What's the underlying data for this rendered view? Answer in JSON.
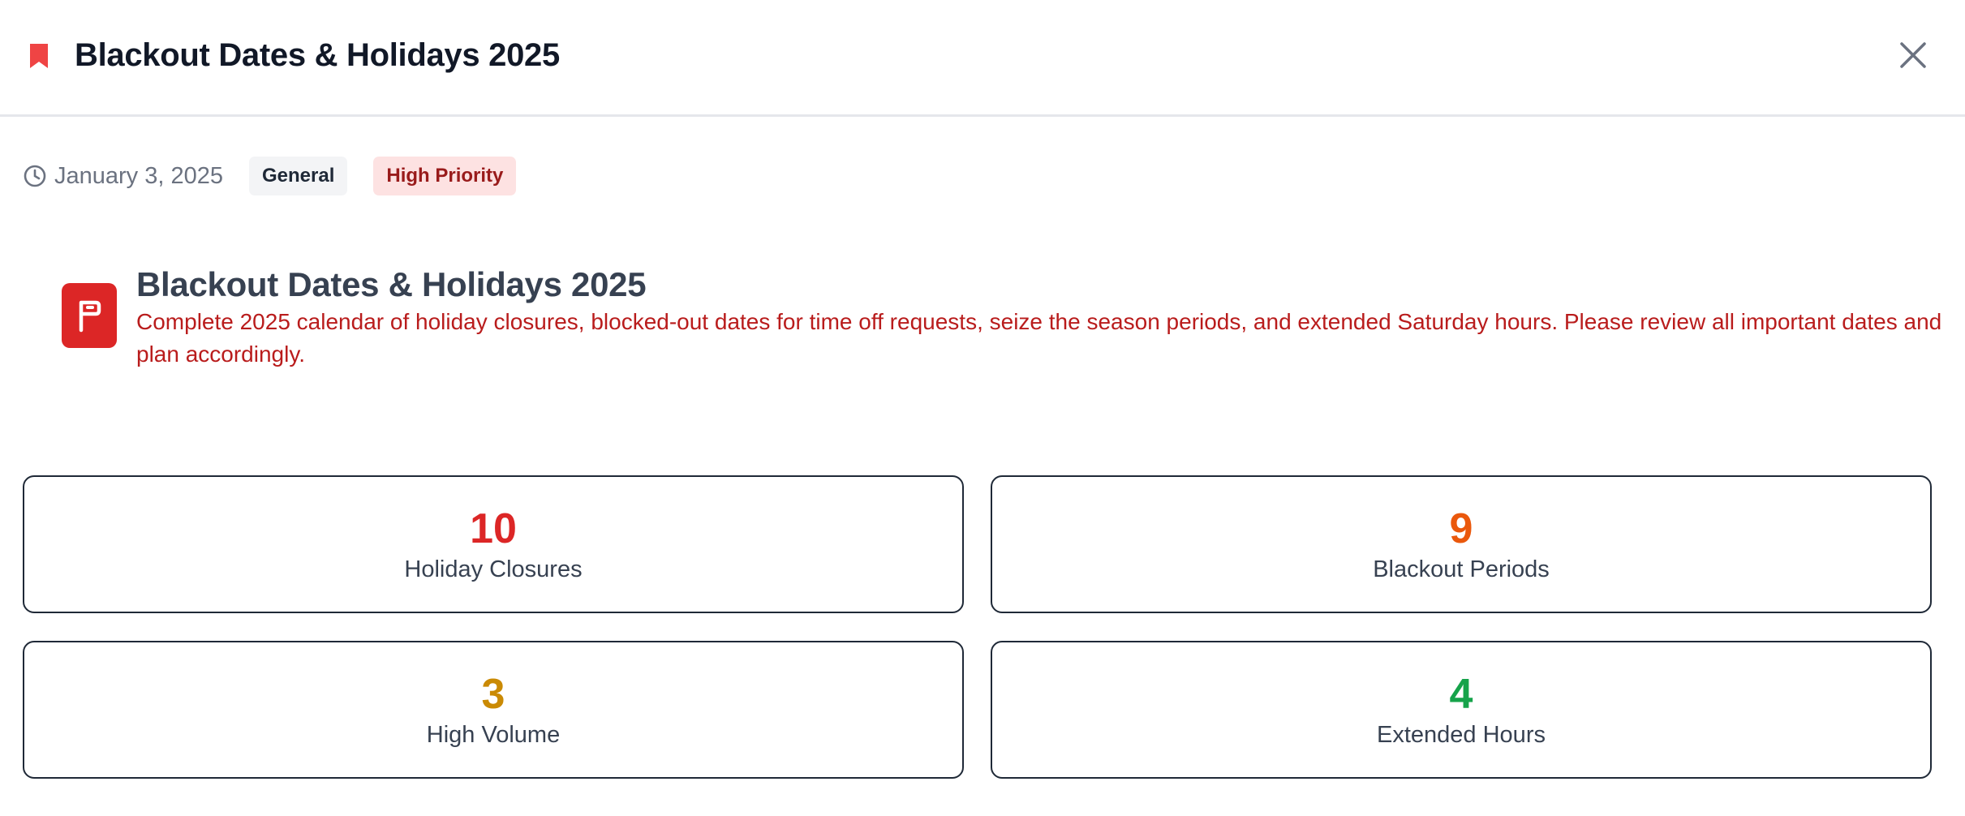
{
  "header": {
    "title": "Blackout Dates & Holidays 2025",
    "bookmark_icon": "bookmark-icon",
    "close_icon": "close-icon"
  },
  "meta": {
    "date": "January 3, 2025",
    "category": "General",
    "priority": "High Priority"
  },
  "notice": {
    "title": "Blackout Dates & Holidays 2025",
    "text": "Complete 2025 calendar of holiday closures, blocked-out dates for time off requests, seize the season periods, and extended Saturday hours. Please review all important dates and plan accordingly.",
    "icon": "flag-icon"
  },
  "stats": [
    {
      "value": "10",
      "label": "Holiday Closures",
      "color": "#dc2626"
    },
    {
      "value": "9",
      "label": "Blackout Periods",
      "color": "#ea580c"
    },
    {
      "value": "3",
      "label": "High Volume",
      "color": "#ca8a04"
    },
    {
      "value": "4",
      "label": "Extended Hours",
      "color": "#16a34a"
    }
  ],
  "colors": {
    "accent_red": "#dc2626",
    "priority_bg": "#fde2e2",
    "priority_text": "#991b1b"
  }
}
